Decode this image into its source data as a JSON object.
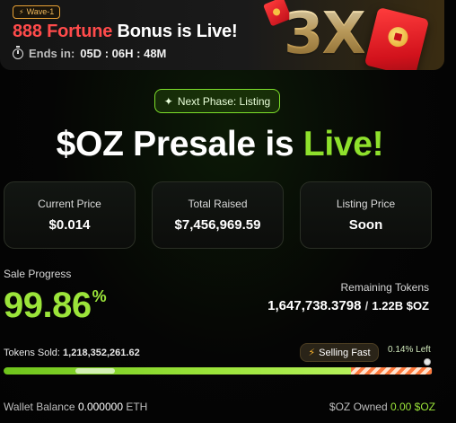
{
  "banner": {
    "wave_label": "Wave-1",
    "title_accent": "888 Fortune",
    "title_rest": "Bonus is Live!",
    "ends_label": "Ends in:",
    "countdown": "05D : 06H : 48M",
    "multiplier": "3X",
    "icons": [
      "bolt-icon",
      "timer-icon",
      "red-envelope-icon"
    ]
  },
  "phase": {
    "label": "Next Phase: Listing",
    "icon": "sparkle-icon"
  },
  "headline": {
    "prefix": "$OZ Presale is",
    "highlight": "Live!"
  },
  "stats": {
    "current_price_label": "Current Price",
    "current_price_value": "$0.014",
    "total_raised_label": "Total Raised",
    "total_raised_value": "$7,456,969.59",
    "listing_price_label": "Listing Price",
    "listing_price_value": "Soon"
  },
  "progress": {
    "sale_label": "Sale Progress",
    "sale_percent": "99.86",
    "percent_sign": "%",
    "remaining_label": "Remaining Tokens",
    "remaining_value": "1,647,738.3798",
    "remaining_separator": "/",
    "remaining_total": "1.22B $OZ",
    "tokens_sold_label": "Tokens Sold:",
    "tokens_sold_value": "1,218,352,261.62",
    "selling_badge": "Selling Fast",
    "left_label": "0.14% Left",
    "fill_fraction": 0.9986
  },
  "footer": {
    "wallet_label": "Wallet Balance",
    "wallet_value": "0.000000",
    "wallet_unit": "ETH",
    "owned_label": "$OZ Owned",
    "owned_value": "0.00 $OZ"
  },
  "colors": {
    "accent_green": "#9be43a",
    "accent_red": "#ff4b4b",
    "gold": "#d9b46a",
    "background": "#050505"
  }
}
